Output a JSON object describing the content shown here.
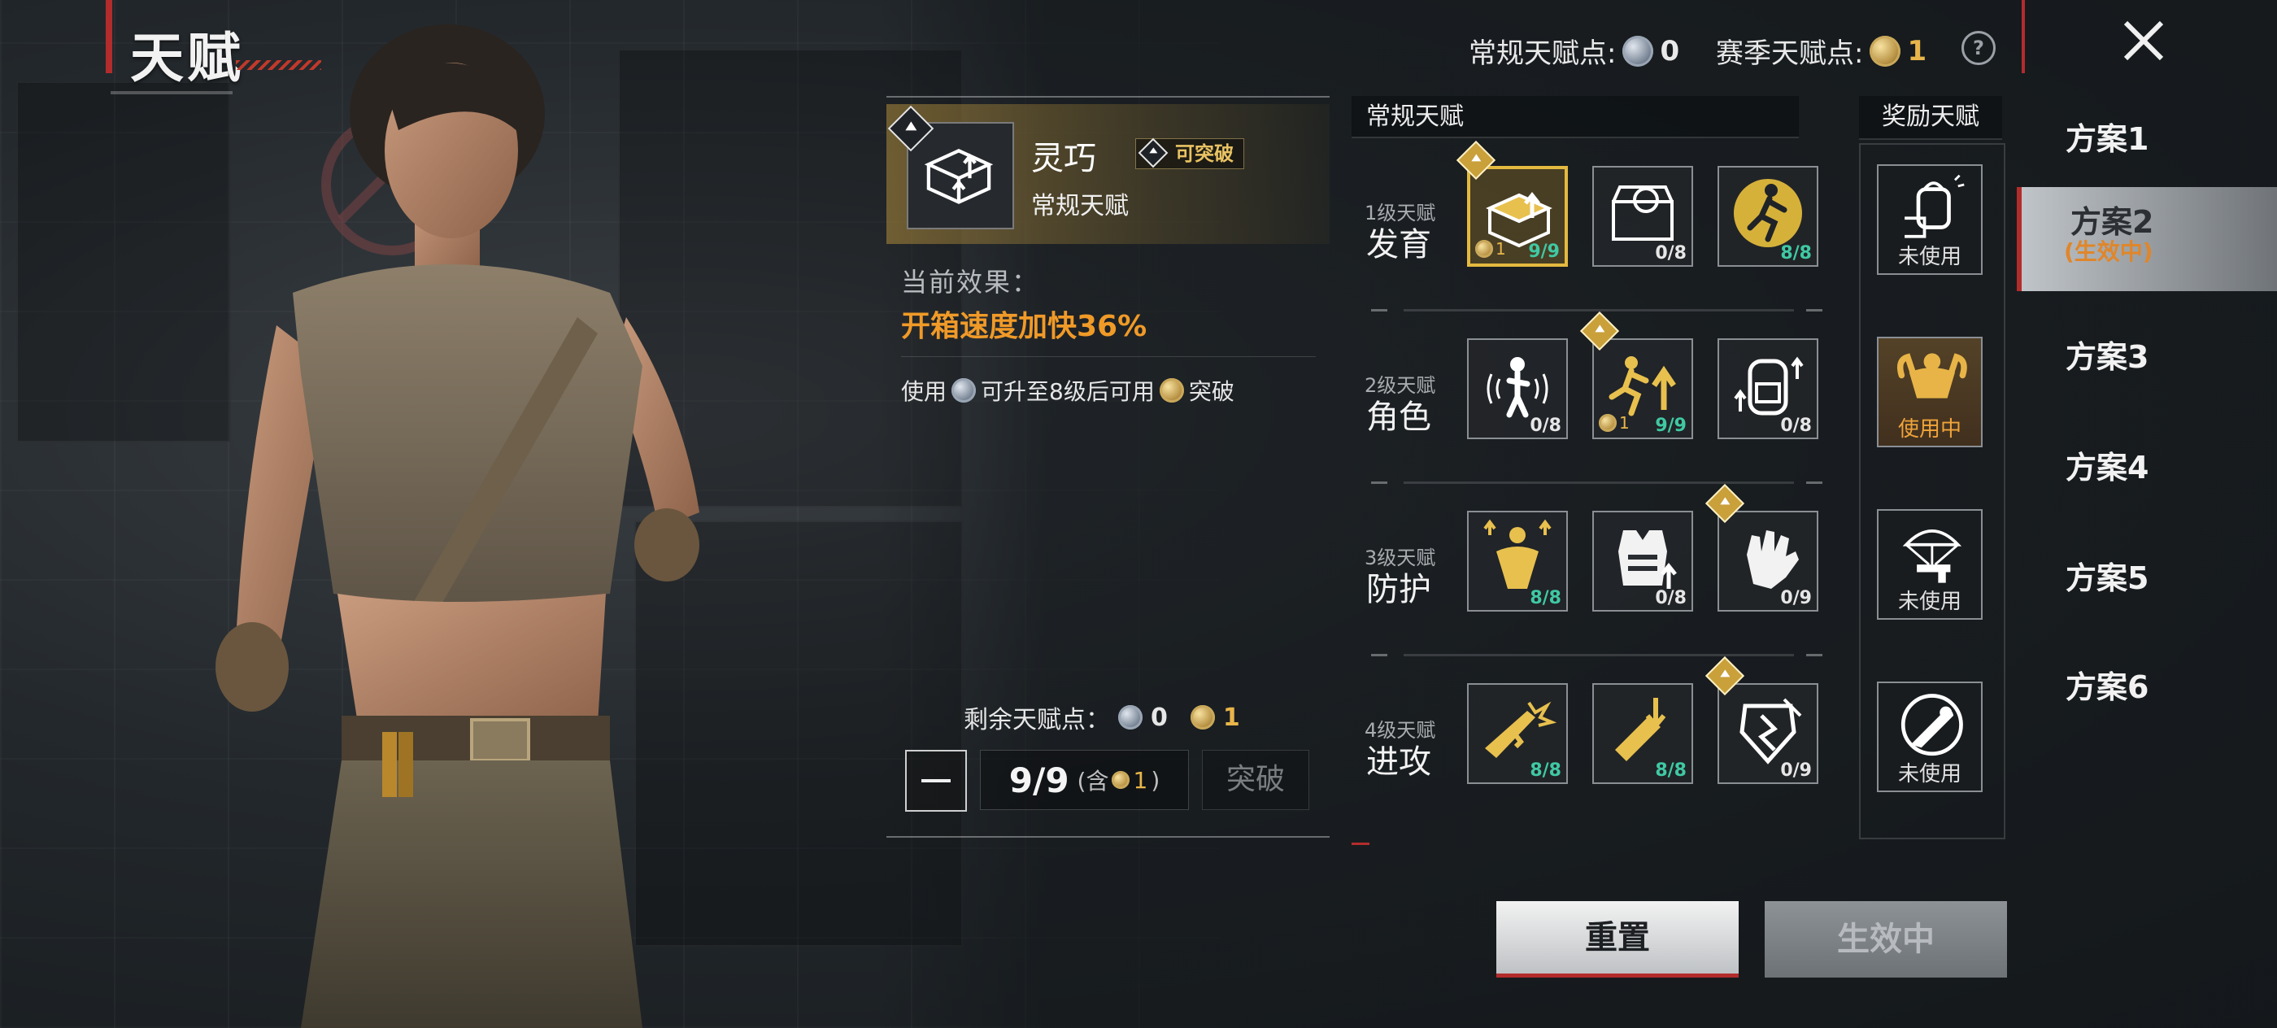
{
  "page_title": "天赋",
  "currency": {
    "regular_label": "常规天赋点:",
    "regular_value": "0",
    "season_label": "赛季天赋点:",
    "season_value": "1",
    "help_icon": "question-circle-icon"
  },
  "detail": {
    "name": "灵巧",
    "breakable_badge": "可突破",
    "type": "常规天赋",
    "effect_label": "当前效果：",
    "effect_value": "开箱速度加快36%",
    "usage_prefix": "使用",
    "usage_middle": "可升至8级后可用",
    "usage_suffix": "突破",
    "remaining_label": "剩余天赋点：",
    "remaining_regular": "0",
    "remaining_season": "1",
    "level": "9/9",
    "level_note_prefix": "(含",
    "level_note_value": "1",
    "level_note_suffix": ")",
    "break_button": "突破"
  },
  "tree": {
    "regular_header": "常规天赋",
    "reward_header": "奖励天赋",
    "rows": [
      {
        "tier_small": "1级天赋",
        "tier_name": "发育",
        "tiles": [
          {
            "icon": "supply-box-upgrade-icon",
            "count": "9/9",
            "coin": "1",
            "selected": true,
            "tag": true,
            "count_color": "green"
          },
          {
            "icon": "treasure-chest-icon",
            "count": "0/8",
            "coin": "",
            "selected": false,
            "tag": false,
            "count_color": "white"
          },
          {
            "icon": "running-soldier-icon",
            "count": "8/8",
            "coin": "",
            "selected": false,
            "tag": false,
            "count_color": "green"
          }
        ],
        "reward": {
          "icon": "backpack-hand-icon",
          "label": "未使用",
          "active": false
        }
      },
      {
        "tier_small": "2级天赋",
        "tier_name": "角色",
        "tiles": [
          {
            "icon": "soldier-sound-icon",
            "count": "0/8",
            "coin": "",
            "selected": false,
            "tag": false,
            "count_color": "white"
          },
          {
            "icon": "sprint-speed-icon",
            "count": "9/9",
            "coin": "1",
            "selected": false,
            "tag": true,
            "count_color": "green"
          },
          {
            "icon": "backpack-upgrade-icon",
            "count": "0/8",
            "coin": "",
            "selected": false,
            "tag": false,
            "count_color": "white"
          }
        ],
        "reward": {
          "icon": "muscle-man-icon",
          "label": "使用中",
          "active": true
        }
      },
      {
        "tier_small": "3级天赋",
        "tier_name": "防护",
        "tiles": [
          {
            "icon": "strong-body-icon",
            "count": "8/8",
            "coin": "",
            "selected": false,
            "tag": false,
            "count_color": "green"
          },
          {
            "icon": "armor-vest-icon",
            "count": "0/8",
            "coin": "",
            "selected": false,
            "tag": false,
            "count_color": "white"
          },
          {
            "icon": "glove-icon",
            "count": "0/9",
            "coin": "",
            "selected": false,
            "tag": true,
            "count_color": "white"
          }
        ],
        "reward": {
          "icon": "parachute-gun-icon",
          "label": "未使用",
          "active": false
        }
      },
      {
        "tier_small": "4级天赋",
        "tier_name": "进攻",
        "tiles": [
          {
            "icon": "rifle-explosion-icon",
            "count": "8/8",
            "coin": "",
            "selected": false,
            "tag": false,
            "count_color": "green"
          },
          {
            "icon": "bullet-rain-icon",
            "count": "8/8",
            "coin": "",
            "selected": false,
            "tag": false,
            "count_color": "green"
          },
          {
            "icon": "armor-break-icon",
            "count": "0/9",
            "coin": "",
            "selected": false,
            "tag": true,
            "count_color": "white"
          }
        ],
        "reward": {
          "icon": "bullet-shield-icon",
          "label": "未使用",
          "active": false
        }
      }
    ]
  },
  "schemes": [
    {
      "label": "方案1",
      "sub": "",
      "active": false
    },
    {
      "label": "方案2",
      "sub": "(生效中)",
      "active": true
    },
    {
      "label": "方案3",
      "sub": "",
      "active": false
    },
    {
      "label": "方案4",
      "sub": "",
      "active": false
    },
    {
      "label": "方案5",
      "sub": "",
      "active": false
    },
    {
      "label": "方案6",
      "sub": "",
      "active": false
    }
  ],
  "buttons": {
    "reset": "重置",
    "active": "生效中"
  },
  "colors": {
    "accent_red": "#b32c2c",
    "gold": "#e4b93f",
    "effect_orange": "#f09a28",
    "count_green": "#3fc9a4"
  }
}
